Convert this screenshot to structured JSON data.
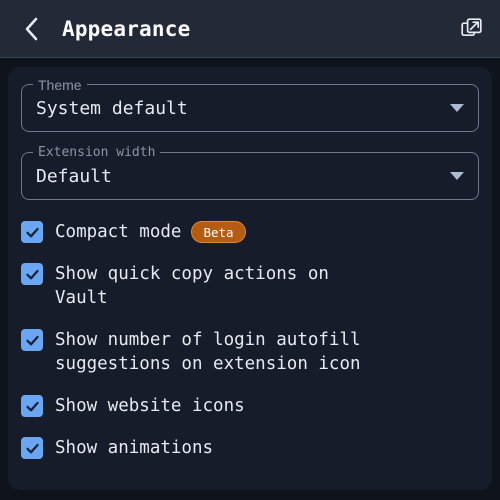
{
  "header": {
    "title": "Appearance",
    "back_icon": "chevron-left-icon",
    "popout_icon": "popout-icon"
  },
  "colors": {
    "page_background": "#0f131c",
    "header_background": "#222937",
    "panel_background": "#161c29",
    "divider": "#3a4358",
    "accent_checkbox": "#6ba6f2",
    "checkmark": "#14243c",
    "badge_background": "#b35c12",
    "badge_border": "#e08a2e",
    "text_primary": "#e7eaf0",
    "label_muted": "#8b94a8",
    "field_border": "#6d7689",
    "caret": "#aebad2"
  },
  "fields": [
    {
      "name": "theme",
      "label": "Theme",
      "value": "System default",
      "caret_icon": "chevron-down-icon"
    },
    {
      "name": "extension-width",
      "label": "Extension width",
      "value": "Default",
      "caret_icon": "chevron-down-icon"
    }
  ],
  "checkboxes": [
    {
      "name": "compact-mode",
      "label": "Compact mode",
      "checked": true,
      "badge": "Beta"
    },
    {
      "name": "show-quick-copy-actions",
      "label": "Show quick copy actions on Vault",
      "checked": true,
      "badge": null
    },
    {
      "name": "show-autofill-suggestions-count",
      "label": "Show number of login autofill suggestions on extension icon",
      "checked": true,
      "badge": null
    },
    {
      "name": "show-website-icons",
      "label": "Show website icons",
      "checked": true,
      "badge": null
    },
    {
      "name": "show-animations",
      "label": "Show animations",
      "checked": true,
      "badge": null
    }
  ]
}
